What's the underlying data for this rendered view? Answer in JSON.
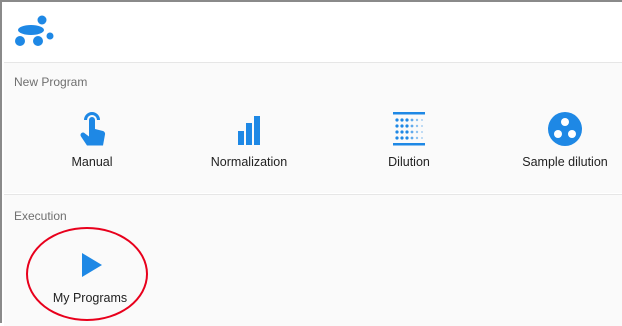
{
  "app": {
    "logo_icon": "brand-logo-icon",
    "accent_color": "#1e88e5",
    "annotation_color": "#e8001c"
  },
  "new_program": {
    "title": "New Program",
    "tiles": [
      {
        "label": "Manual",
        "icon": "touch-hand-icon"
      },
      {
        "label": "Normalization",
        "icon": "bar-chart-icon"
      },
      {
        "label": "Dilution",
        "icon": "dilution-grid-icon"
      },
      {
        "label": "Sample dilution",
        "icon": "sample-dots-icon"
      }
    ]
  },
  "execution": {
    "title": "Execution",
    "tiles": [
      {
        "label": "My Programs",
        "icon": "play-icon"
      }
    ]
  }
}
